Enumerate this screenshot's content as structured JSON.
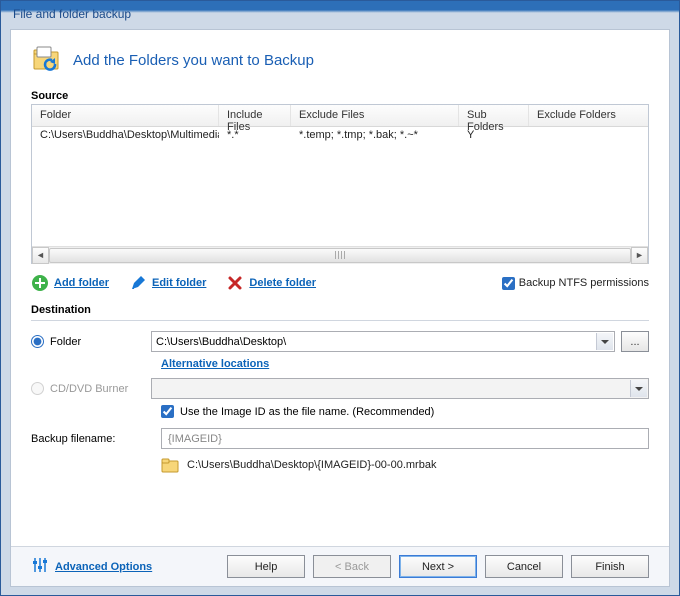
{
  "window": {
    "title": "File and folder backup"
  },
  "header": {
    "title": "Add the Folders you want to Backup"
  },
  "source": {
    "label": "Source",
    "columns": {
      "folder": "Folder",
      "include": "Include Files",
      "exclude": "Exclude Files",
      "sub": "Sub Folders",
      "exfolders": "Exclude Folders"
    },
    "rows": [
      {
        "folder": "C:\\Users\\Buddha\\Desktop\\Multimedia\\",
        "include": "*.*",
        "exclude": "*.temp; *.tmp; *.bak; *.~*",
        "sub": "Y",
        "exfolders": ""
      }
    ],
    "actions": {
      "add": "Add folder",
      "edit": "Edit folder",
      "delete": "Delete folder"
    },
    "ntfs": {
      "label": "Backup NTFS permissions",
      "checked": true
    }
  },
  "destination": {
    "label": "Destination",
    "folder_radio": "Folder",
    "folder_path": "C:\\Users\\Buddha\\Desktop\\",
    "browse_btn": "...",
    "alt_locations": "Alternative locations",
    "cd_radio": "CD/DVD Burner",
    "use_imageid": {
      "label": "Use the Image ID as the file name.  (Recommended)",
      "checked": true
    },
    "filename_label": "Backup filename:",
    "filename_value": "{IMAGEID}",
    "result_path": "C:\\Users\\Buddha\\Desktop\\{IMAGEID}-00-00.mrbak"
  },
  "footer": {
    "advanced": "Advanced Options",
    "help": "Help",
    "back": "< Back",
    "next": "Next >",
    "cancel": "Cancel",
    "finish": "Finish"
  }
}
